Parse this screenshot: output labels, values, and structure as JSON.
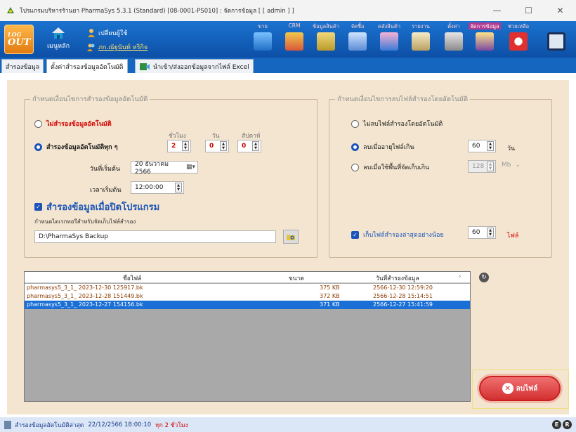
{
  "window": {
    "title": "โปรแกรมบริหารร้านยา PharmaSys 5.3.1 (Standard) [08-0001-PS010] : จัดการข้อมูล [ [ admin ] ]",
    "minimize": "—",
    "maximize": "☐",
    "close": "✕"
  },
  "ribbon": {
    "logout_line1": "LOG",
    "logout_line2": "OUT",
    "home_label": "เมนูหลัก",
    "switch_user": "เปลี่ยนผู้ใช้",
    "user_name": "ภก.ณัฐนันท์ หริกิจ",
    "tools": [
      {
        "label": "ขาย",
        "icon": "pos-icon"
      },
      {
        "label": "CRM",
        "icon": "crm-icon"
      },
      {
        "label": "ข้อมูลสินค้า",
        "icon": "product-data-icon"
      },
      {
        "label": "จัดซื้อ",
        "icon": "purchase-icon"
      },
      {
        "label": "คลังสินค้า",
        "icon": "stock-icon"
      },
      {
        "label": "รายงาน",
        "icon": "report-icon"
      },
      {
        "label": "ตั้งค่า",
        "icon": "settings-icon"
      },
      {
        "label": "จัดการข้อมูล",
        "icon": "data-manage-icon"
      },
      {
        "label": "ช่วยเหลือ",
        "icon": "help-icon"
      },
      {
        "label": "",
        "icon": "exit-icon"
      }
    ]
  },
  "tabs": [
    {
      "label": "สำรองข้อมูล"
    },
    {
      "label": "ตั้งค่าสำรองข้อมูลอัตโนมัติ"
    },
    {
      "label": "นำเข้า/ส่งออกข้อมูลจากไฟล์ Excel"
    }
  ],
  "auto_backup": {
    "group_title": "กำหนดเงื่อนไขการสำรองข้อมูลอัตโนมัติ",
    "no_auto_label": "ไม่สำรองข้อมูลอัตโนมัติ",
    "auto_every_label": "สำรองข้อมูลอัตโนมัติทุก ๆ",
    "hours_head": "ชั่วโมง",
    "days_head": "วัน",
    "weeks_head": "สัปดาห์",
    "hours_value": "2",
    "days_value": "0",
    "weeks_value": "0",
    "start_date_label": "วันที่เริ่มต้น",
    "start_date_value": "20  ธันวาคม    2566",
    "start_time_label": "เวลาเริ่มต้น",
    "start_time_value": "12:00:00",
    "on_close_label": "สำรองข้อมูลเมื่อปิดโปรแกรม",
    "dir_label": "กำหนดไดเรกทอรีสำหรับจัดเก็บไฟล์สำรอง",
    "dir_value": "D:\\PharmaSys Backup"
  },
  "auto_delete": {
    "group_title": "กำหนดเงื่อนไขการลบไฟล์สำรองโดยอัตโนมัติ",
    "no_delete_label": "ไม่ลบไฟล์สำรองโดยอัตโนมัติ",
    "age_label": "ลบเมื่ออายุไฟล์เกิน",
    "age_value": "60",
    "age_unit": "วัน",
    "space_label": "ลบเมื่อใช้พื้นที่จัดเก็บเกิน",
    "space_value": "128",
    "space_unit": "Mb",
    "keep_min_label": "เก็บไฟล์สำรองล่าสุดอย่างน้อย",
    "keep_min_value": "60",
    "keep_min_unit": "ไฟล์"
  },
  "table": {
    "headers": [
      "ชื่อไฟล์",
      "ขนาด",
      "วันที่สำรองข้อมูล"
    ],
    "rows": [
      {
        "name": "pharmasys5_3_1_ 2023-12-30 125917.bk",
        "size": "375 KB",
        "date": "2566-12-30 12:59:20"
      },
      {
        "name": "pharmasys5_3_1_ 2023-12-28 151449.bk",
        "size": "372 KB",
        "date": "2566-12-28 15:14:51"
      },
      {
        "name": "pharmasys5_3_1_ 2023-12-27 154156.bk",
        "size": "371 KB",
        "date": "2566-12-27 15:41:59"
      }
    ]
  },
  "delete_button": "ลบไฟล์",
  "status": {
    "last_backup_label": "สำรองข้อมูลอัตโนมัติล่าสุด",
    "last_backup_value": "22/12/2566 18:00:10",
    "interval": "ทุก 2 ชั่วโมง"
  },
  "colors": {
    "accent": "#1a54b8",
    "ribbon": "#1566bf",
    "panel": "#f3e5cf",
    "selected_row": "#1a6fd6",
    "danger": "#d40000"
  }
}
